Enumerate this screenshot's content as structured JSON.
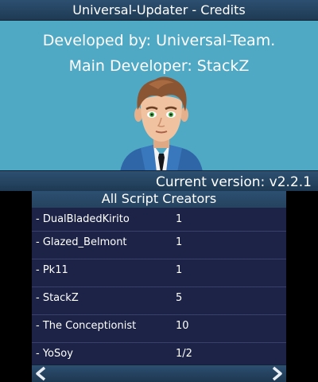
{
  "window": {
    "title": "Universal-Updater - Credits"
  },
  "credits": {
    "developed_by": "Developed by: Universal-Team.",
    "main_developer": "Main Developer: StackZ"
  },
  "version": {
    "text": "Current version: v2.2.1"
  },
  "scripts_panel": {
    "header": "All Script Creators",
    "creators": [
      {
        "name": "- DualBladedKirito",
        "count": "1"
      },
      {
        "name": "- Glazed_Belmont",
        "count": "1"
      },
      {
        "name": "- Pk11",
        "count": "1"
      },
      {
        "name": "- StackZ",
        "count": "5"
      },
      {
        "name": "- The Conceptionist",
        "count": "10"
      },
      {
        "name": "- YoSoy",
        "count": "1/2"
      }
    ]
  },
  "navigation": {
    "prev_icon": "chevron-left-icon",
    "next_icon": "chevron-right-icon"
  },
  "colors": {
    "top_background": "#4fa9c5",
    "bar": "#24435f",
    "list_background": "#1c2346"
  }
}
